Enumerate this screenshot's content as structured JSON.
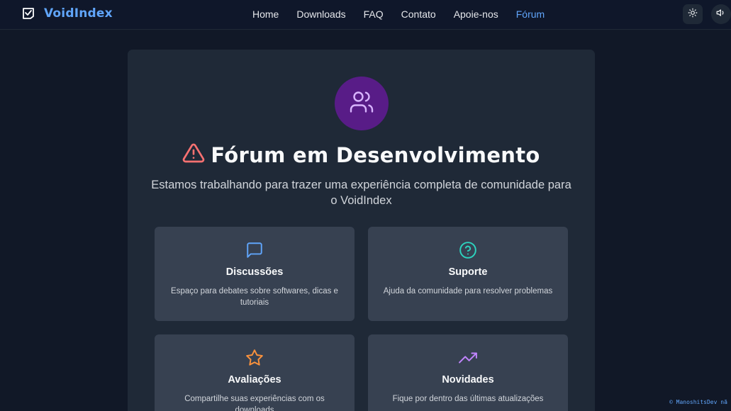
{
  "nav": {
    "brand": "VoidIndex",
    "links": [
      "Home",
      "Downloads",
      "FAQ",
      "Contato",
      "Apoie-nos",
      "Fórum"
    ],
    "active_link": "Fórum"
  },
  "hero": {
    "title": "Fórum em Desenvolvimento",
    "subtitle": "Estamos trabalhando para trazer uma experiência completa de comunidade para o VoidIndex"
  },
  "features": [
    {
      "title": "Discussões",
      "description": "Espaço para debates sobre softwares, dicas e tutoriais",
      "icon": "message-square-icon",
      "color": "#60a5fa"
    },
    {
      "title": "Suporte",
      "description": "Ajuda da comunidade para resolver problemas",
      "icon": "help-circle-icon",
      "color": "#2dd4bf"
    },
    {
      "title": "Avaliações",
      "description": "Compartilhe suas experiências com os downloads",
      "icon": "star-icon",
      "color": "#fb923c"
    },
    {
      "title": "Novidades",
      "description": "Fique por dentro das últimas atualizações",
      "icon": "trending-up-icon",
      "color": "#c084fc"
    }
  ],
  "footer": {
    "credit": "© ManoshitsDev nã"
  },
  "colors": {
    "accent": "#60a5fa",
    "background": "#111827",
    "card": "#1f2937",
    "hero_icon_bg": "#581c87",
    "warning": "#f87171"
  }
}
